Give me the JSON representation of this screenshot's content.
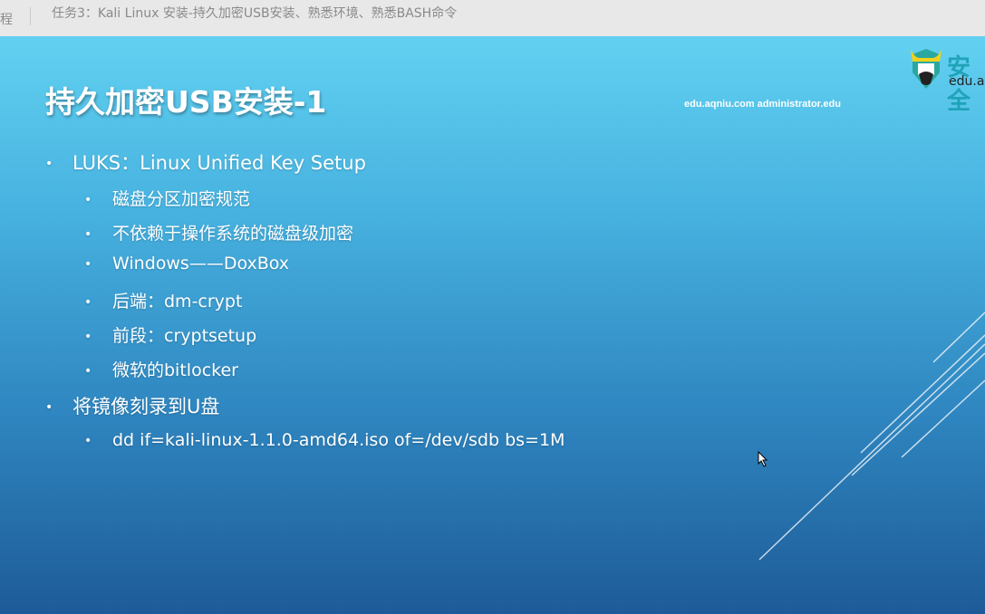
{
  "topbar": {
    "prev_fragment": "程",
    "title": "任务3：Kali Linux 安装-持久加密USB安装、熟悉环境、熟悉BASH命令"
  },
  "slide": {
    "title": "持久加密USB安装-1",
    "watermark": "edu.aqniu.com administrator.edu",
    "logo": {
      "text": "安全",
      "sub": "edu.aq"
    },
    "bullets": [
      {
        "level": 1,
        "text": "LUKS：Linux Unified Key Setup"
      },
      {
        "level": 2,
        "text": "磁盘分区加密规范"
      },
      {
        "level": 2,
        "text": "不依赖于操作系统的磁盘级加密"
      },
      {
        "level": 2,
        "text": "Windows——DoxBox"
      },
      {
        "level": 2,
        "text": "后端：dm-crypt"
      },
      {
        "level": 2,
        "text": "前段：cryptsetup"
      },
      {
        "level": 2,
        "text": "微软的bitlocker"
      },
      {
        "level": 1,
        "text": "将镜像刻录到U盘"
      },
      {
        "level": 2,
        "text": "dd if=kali-linux-1.1.0-amd64.iso of=/dev/sdb bs=1M"
      }
    ]
  }
}
